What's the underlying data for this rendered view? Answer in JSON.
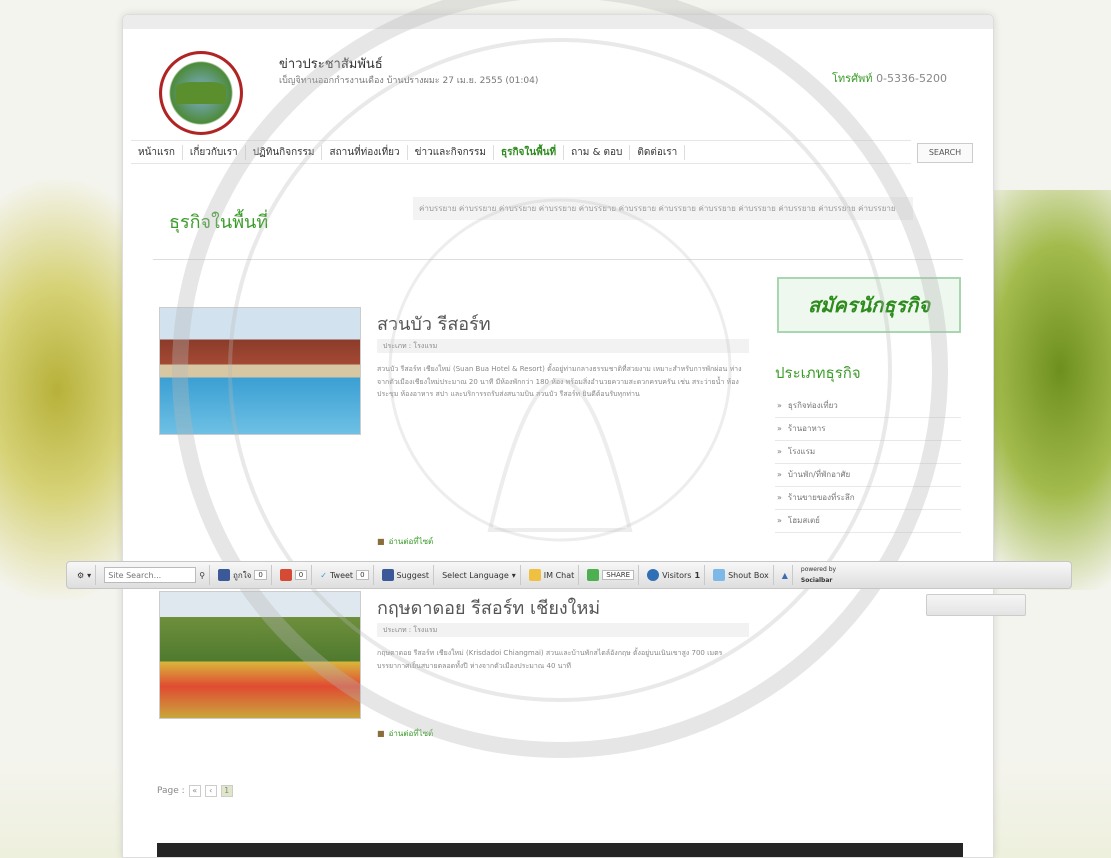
{
  "header": {
    "site_title": "ข่าวประชาสัมพันธ์",
    "site_sub": "เบ็ญจิทานออกกำรงานเดือง บ้านปรางผมะ 27 เม.ย. 2555 (01:04)",
    "phone_label": "โทรศัพท์",
    "phone_number": "0-5336-5200"
  },
  "nav": {
    "items": [
      "หน้าแรก",
      "เกี่ยวกับเรา",
      "ปฏิทินกิจกรรม",
      "สถานที่ท่องเที่ยว",
      "ข่าวและกิจกรรม",
      "ธุรกิจในพื้นที่",
      "ถาม & ตอบ",
      "ติดต่อเรา"
    ],
    "active_index": 5,
    "search_label": "SEARCH"
  },
  "section": {
    "title": "ธุรกิจในพื้นที่",
    "intro": "ค่าบรรยาย ค่าบรรยาย ค่าบรรยาย ค่าบรรยาย ค่าบรรยาย ค่าบรรยาย ค่าบรรยาย ค่าบรรยาย ค่าบรรยาย ค่าบรรยาย ค่าบรรยาย ค่าบรรยาย"
  },
  "items": [
    {
      "title": "สวนบัว รีสอร์ท",
      "type": "ประเภท : โรงแรม",
      "desc": "สวนบัว รีสอร์ท เชียงใหม่ (Suan Bua Hotel & Resort) ตั้งอยู่ท่ามกลางธรรมชาติที่สวยงาม เหมาะสำหรับการพักผ่อน ห่างจากตัวเมืองเชียงใหม่ประมาณ 20 นาที มีห้องพักกว่า 180 ห้อง พร้อมสิ่งอำนวยความสะดวกครบครัน เช่น สระว่ายน้ำ ห้องประชุม ห้องอาหาร สปา และบริการรถรับส่งสนามบิน สวนบัว รีสอร์ท ยินดีต้อนรับทุกท่าน",
      "more": "อ่านต่อที่ไซต์"
    },
    {
      "title": "กฤษดาดอย รีสอร์ท เชียงใหม่",
      "type": "ประเภท : โรงแรม",
      "desc": "กฤษดาดอย รีสอร์ท เชียงใหม่ (Krisdadoi Chiangmai) สวนและบ้านพักสไตล์อังกฤษ ตั้งอยู่บนเนินเขาสูง 700 เมตร บรรยากาศเย็นสบายตลอดทั้งปี ห่างจากตัวเมืองประมาณ 40 นาที",
      "more": "อ่านต่อที่ไซต์"
    }
  ],
  "pager": {
    "label": "Page :",
    "prev": "«",
    "next": "‹",
    "current": "1"
  },
  "sidebar": {
    "register_button": "สมัครนักธุรกิจ",
    "category_title": "ประเภทธุรกิจ",
    "categories": [
      "ธุรกิจท่องเที่ยว",
      "ร้านอาหาร",
      "โรงแรม",
      "บ้านพัก/ที่พักอาศัย",
      "ร้านขายของที่ระลึก",
      "โฮมสเตย์"
    ]
  },
  "toolbar": {
    "search_placeholder": "Site Search...",
    "like_label": "ถูกใจ",
    "like_count": "0",
    "plusone_count": "0",
    "tweet_label": "Tweet",
    "tweet_count": "0",
    "suggest_label": "Suggest",
    "language_label": "Select Language",
    "imchat_label": "IM Chat",
    "share_label": "SHARE",
    "visitors_label": "Visitors",
    "visitors_count": "1",
    "shoutbox_label": "Shout Box",
    "brand_top": "powered by",
    "brand_name": "Socialbar"
  },
  "colors": {
    "accent": "#3b9c2a",
    "footer": "#252525"
  }
}
